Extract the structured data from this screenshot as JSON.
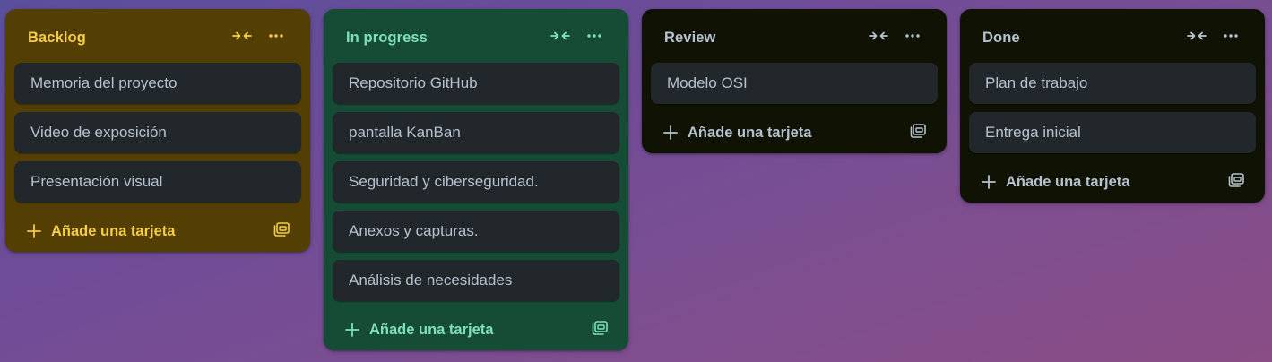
{
  "columns": [
    {
      "title": "Backlog",
      "bg": "#533f04",
      "accent": "#f5cd47",
      "cards": [
        "Memoria del proyecto",
        "Video de exposición",
        "Presentación visual"
      ],
      "add_label": "Añade una tarjeta",
      "collapse_icon": "collapse-arrows-icon",
      "menu_icon": "more-dots-icon",
      "template_icon": "card-template-icon"
    },
    {
      "title": "In progress",
      "bg": "#164b35",
      "accent": "#7ee2b8",
      "cards": [
        "Repositorio GitHub",
        "pantalla KanBan",
        "Seguridad y ciberseguridad.",
        "Anexos y capturas.",
        "Análisis de necesidades"
      ],
      "add_label": "Añade una tarjeta",
      "collapse_icon": "collapse-arrows-icon",
      "menu_icon": "more-dots-icon",
      "template_icon": "card-template-icon"
    },
    {
      "title": "Review",
      "bg": "#101204",
      "accent": "#b6c2cf",
      "cards": [
        "Modelo OSI"
      ],
      "add_label": "Añade una tarjeta",
      "collapse_icon": "collapse-arrows-icon",
      "menu_icon": "more-dots-icon",
      "template_icon": "card-template-icon"
    },
    {
      "title": "Done",
      "bg": "#101204",
      "accent": "#b6c2cf",
      "cards": [
        "Plan de trabajo",
        "Entrega inicial"
      ],
      "add_label": "Añade una tarjeta",
      "collapse_icon": "collapse-arrows-icon",
      "menu_icon": "more-dots-icon",
      "template_icon": "card-template-icon"
    }
  ]
}
